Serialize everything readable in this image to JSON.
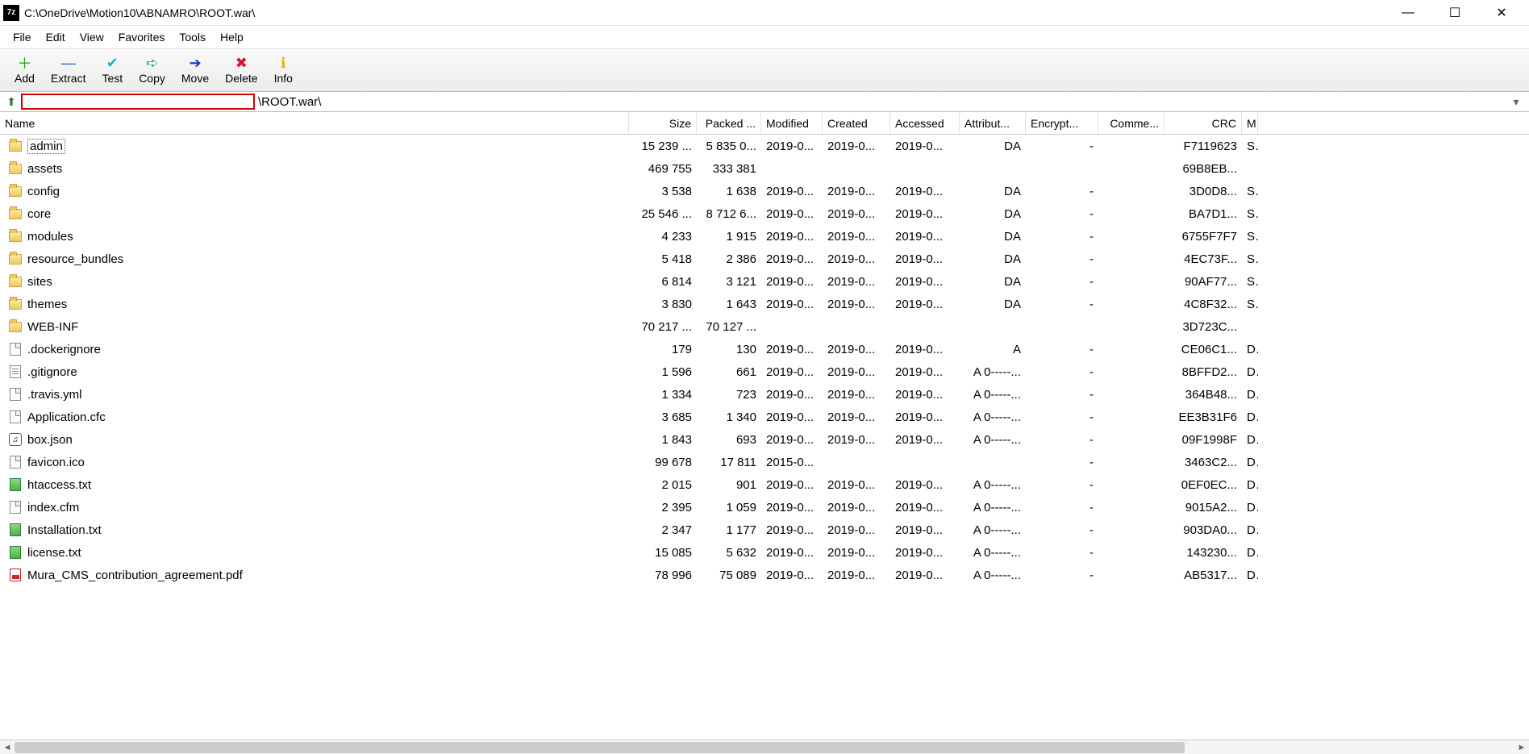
{
  "window": {
    "title": "C:\\OneDrive\\Motion10\\ABNAMRO\\ROOT.war\\",
    "app_icon_text": "7z"
  },
  "menu": [
    "File",
    "Edit",
    "View",
    "Favorites",
    "Tools",
    "Help"
  ],
  "toolbar": [
    {
      "label": "Add",
      "icon": "＋",
      "color": "#19a619"
    },
    {
      "label": "Extract",
      "icon": "—",
      "color": "#1b5bd1"
    },
    {
      "label": "Test",
      "icon": "✔",
      "color": "#17b8c9"
    },
    {
      "label": "Copy",
      "icon": "➪",
      "color": "#1aa59a"
    },
    {
      "label": "Move",
      "icon": "➔",
      "color": "#1833c2"
    },
    {
      "label": "Delete",
      "icon": "✖",
      "color": "#d4142a"
    },
    {
      "label": "Info",
      "icon": "ℹ",
      "color": "#e0b40a"
    }
  ],
  "path_suffix": "\\ROOT.war\\",
  "columns": [
    "Name",
    "Size",
    "Packed ...",
    "Modified",
    "Created",
    "Accessed",
    "Attribut...",
    "Encrypt...",
    "Comme...",
    "CRC",
    "M"
  ],
  "files": [
    {
      "icon": "folder",
      "name": "admin",
      "size": "15 239 ...",
      "packed": "5 835 0...",
      "modified": "2019-0...",
      "created": "2019-0...",
      "accessed": "2019-0...",
      "attr": "DA",
      "enc": "-",
      "comm": "",
      "crc": "F7119623",
      "m": "S",
      "sel": true
    },
    {
      "icon": "folder",
      "name": "assets",
      "size": "469 755",
      "packed": "333 381",
      "modified": "",
      "created": "",
      "accessed": "",
      "attr": "",
      "enc": "",
      "comm": "",
      "crc": "69B8EB...",
      "m": ""
    },
    {
      "icon": "folder",
      "name": "config",
      "size": "3 538",
      "packed": "1 638",
      "modified": "2019-0...",
      "created": "2019-0...",
      "accessed": "2019-0...",
      "attr": "DA",
      "enc": "-",
      "comm": "",
      "crc": "3D0D8...",
      "m": "S"
    },
    {
      "icon": "folder",
      "name": "core",
      "size": "25 546 ...",
      "packed": "8 712 6...",
      "modified": "2019-0...",
      "created": "2019-0...",
      "accessed": "2019-0...",
      "attr": "DA",
      "enc": "-",
      "comm": "",
      "crc": "BA7D1...",
      "m": "S"
    },
    {
      "icon": "folder",
      "name": "modules",
      "size": "4 233",
      "packed": "1 915",
      "modified": "2019-0...",
      "created": "2019-0...",
      "accessed": "2019-0...",
      "attr": "DA",
      "enc": "-",
      "comm": "",
      "crc": "6755F7F7",
      "m": "S"
    },
    {
      "icon": "folder",
      "name": "resource_bundles",
      "size": "5 418",
      "packed": "2 386",
      "modified": "2019-0...",
      "created": "2019-0...",
      "accessed": "2019-0...",
      "attr": "DA",
      "enc": "-",
      "comm": "",
      "crc": "4EC73F...",
      "m": "S"
    },
    {
      "icon": "folder",
      "name": "sites",
      "size": "6 814",
      "packed": "3 121",
      "modified": "2019-0...",
      "created": "2019-0...",
      "accessed": "2019-0...",
      "attr": "DA",
      "enc": "-",
      "comm": "",
      "crc": "90AF77...",
      "m": "S"
    },
    {
      "icon": "folder",
      "name": "themes",
      "size": "3 830",
      "packed": "1 643",
      "modified": "2019-0...",
      "created": "2019-0...",
      "accessed": "2019-0...",
      "attr": "DA",
      "enc": "-",
      "comm": "",
      "crc": "4C8F32...",
      "m": "S"
    },
    {
      "icon": "folder",
      "name": "WEB-INF",
      "size": "70 217 ...",
      "packed": "70 127 ...",
      "modified": "",
      "created": "",
      "accessed": "",
      "attr": "",
      "enc": "",
      "comm": "",
      "crc": "3D723C...",
      "m": ""
    },
    {
      "icon": "file",
      "name": ".dockerignore",
      "size": "179",
      "packed": "130",
      "modified": "2019-0...",
      "created": "2019-0...",
      "accessed": "2019-0...",
      "attr": "A",
      "enc": "-",
      "comm": "",
      "crc": "CE06C1...",
      "m": "D"
    },
    {
      "icon": "txt",
      "name": ".gitignore",
      "size": "1 596",
      "packed": "661",
      "modified": "2019-0...",
      "created": "2019-0...",
      "accessed": "2019-0...",
      "attr": "A 0-----...",
      "enc": "-",
      "comm": "",
      "crc": "8BFFD2...",
      "m": "D"
    },
    {
      "icon": "file",
      "name": ".travis.yml",
      "size": "1 334",
      "packed": "723",
      "modified": "2019-0...",
      "created": "2019-0...",
      "accessed": "2019-0...",
      "attr": "A 0-----...",
      "enc": "-",
      "comm": "",
      "crc": "364B48...",
      "m": "D"
    },
    {
      "icon": "file",
      "name": "Application.cfc",
      "size": "3 685",
      "packed": "1 340",
      "modified": "2019-0...",
      "created": "2019-0...",
      "accessed": "2019-0...",
      "attr": "A 0-----...",
      "enc": "-",
      "comm": "",
      "crc": "EE3B31F6",
      "m": "D"
    },
    {
      "icon": "json",
      "name": "box.json",
      "size": "1 843",
      "packed": "693",
      "modified": "2019-0...",
      "created": "2019-0...",
      "accessed": "2019-0...",
      "attr": "A 0-----...",
      "enc": "-",
      "comm": "",
      "crc": "09F1998F",
      "m": "D"
    },
    {
      "icon": "file",
      "name": "favicon.ico",
      "size": "99 678",
      "packed": "17 811",
      "modified": "2015-0...",
      "created": "",
      "accessed": "",
      "attr": "",
      "enc": "-",
      "comm": "",
      "crc": "3463C2...",
      "m": "D"
    },
    {
      "icon": "green",
      "name": "htaccess.txt",
      "size": "2 015",
      "packed": "901",
      "modified": "2019-0...",
      "created": "2019-0...",
      "accessed": "2019-0...",
      "attr": "A 0-----...",
      "enc": "-",
      "comm": "",
      "crc": "0EF0EC...",
      "m": "D"
    },
    {
      "icon": "file",
      "name": "index.cfm",
      "size": "2 395",
      "packed": "1 059",
      "modified": "2019-0...",
      "created": "2019-0...",
      "accessed": "2019-0...",
      "attr": "A 0-----...",
      "enc": "-",
      "comm": "",
      "crc": "9015A2...",
      "m": "D"
    },
    {
      "icon": "green",
      "name": "Installation.txt",
      "size": "2 347",
      "packed": "1 177",
      "modified": "2019-0...",
      "created": "2019-0...",
      "accessed": "2019-0...",
      "attr": "A 0-----...",
      "enc": "-",
      "comm": "",
      "crc": "903DA0...",
      "m": "D"
    },
    {
      "icon": "green",
      "name": "license.txt",
      "size": "15 085",
      "packed": "5 632",
      "modified": "2019-0...",
      "created": "2019-0...",
      "accessed": "2019-0...",
      "attr": "A 0-----...",
      "enc": "-",
      "comm": "",
      "crc": "143230...",
      "m": "D"
    },
    {
      "icon": "pdf",
      "name": "Mura_CMS_contribution_agreement.pdf",
      "size": "78 996",
      "packed": "75 089",
      "modified": "2019-0...",
      "created": "2019-0...",
      "accessed": "2019-0...",
      "attr": "A 0-----...",
      "enc": "-",
      "comm": "",
      "crc": "AB5317...",
      "m": "D"
    }
  ]
}
